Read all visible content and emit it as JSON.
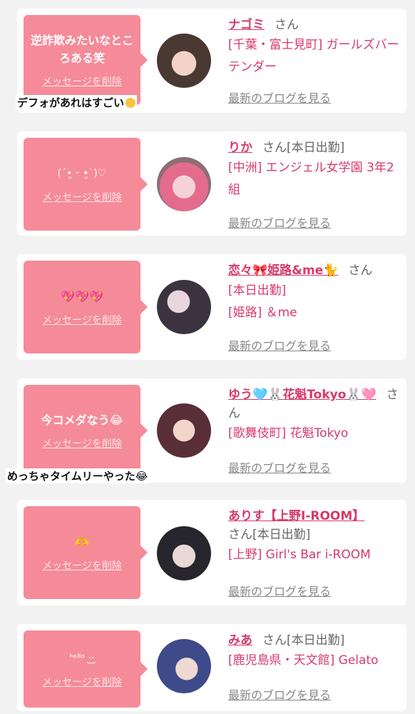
{
  "cards": [
    {
      "message": "逆詐欺みたいなところある笑",
      "delete_label": "メッセージを削除",
      "name": "ナゴミ",
      "san": "さん",
      "status": "",
      "shop": "[千葉・富士見町] ガールズバー テンダー",
      "blog_label": "最新のブログを見る"
    },
    {
      "message": "(ˊ•͈ ᵕ •͈ˋ)♡",
      "delete_label": "メッセージを削除",
      "name": "りか",
      "san": "さん",
      "status": "[本日出勤]",
      "shop": "[中洲] エンジェル女学園 3年2組",
      "blog_label": "最新のブログを見る"
    },
    {
      "message": "💖💖💖",
      "delete_label": "メッセージを削除",
      "name": "恋々🎀姫路&me🐈",
      "san": "さん",
      "status": "[本日出勤]",
      "shop": "[姫路] ＆me",
      "blog_label": "最新のブログを見る"
    },
    {
      "message": "今コメダなう😂",
      "delete_label": "メッセージを削除",
      "name": "ゆう🩵🐰花魁Tokyo🐰🩷",
      "san": "さん",
      "status": "",
      "shop": "[歌舞伎町] 花魁Tokyo",
      "blog_label": "最新のブログを見る"
    },
    {
      "message": "🫶",
      "delete_label": "メッセージを削除",
      "name": "ありす【上野I-ROOM】",
      "san": "さん",
      "status": "[本日出勤]",
      "shop": "[上野] Girl's Bar i-ROOM",
      "blog_label": "最新のブログを見る"
    },
    {
      "message": "ᑋᵉᑊᑊᵒ ·͜·",
      "delete_label": "メッセージを削除",
      "name": "みあ",
      "san": "さん",
      "status": "[本日出勤]",
      "shop": "[鹿児島県・天文館] Gelato",
      "blog_label": "最新のブログを見る"
    }
  ],
  "overlays": {
    "first": "デフォがあれはすごい",
    "second": "めっちゃタイムリーやった😂"
  },
  "colors": {
    "accent_pink": "#f58b98",
    "name_pink": "#d63a69"
  }
}
